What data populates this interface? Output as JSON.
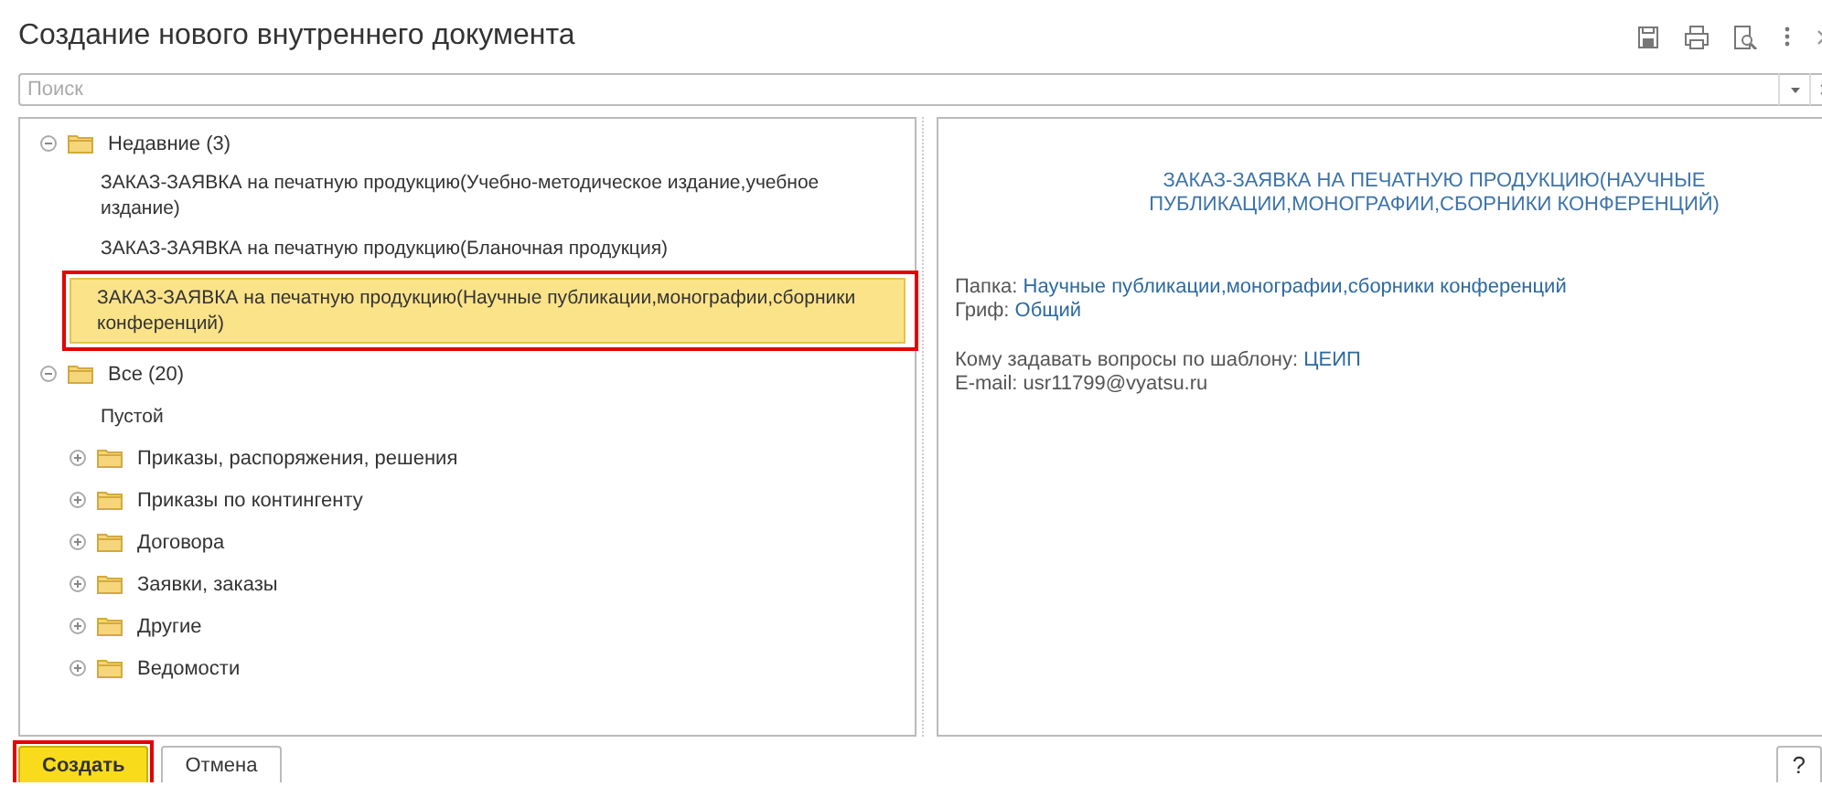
{
  "window": {
    "title": "Создание нового внутреннего документа"
  },
  "search": {
    "placeholder": "Поиск"
  },
  "tree": [
    {
      "kind": "folder",
      "label": "Недавние (3)",
      "expanded": true,
      "children": [
        {
          "kind": "item",
          "label": "ЗАКАЗ-ЗАЯВКА на печатную продукцию(Учебно-методическое издание,учебное издание)",
          "selected": false,
          "outlined": false
        },
        {
          "kind": "item",
          "label": "ЗАКАЗ-ЗАЯВКА на печатную продукцию(Бланочная продукция)",
          "selected": false,
          "outlined": false
        },
        {
          "kind": "item",
          "label": "ЗАКАЗ-ЗАЯВКА на печатную продукцию(Научные публикации,монографии,сборники конференций)",
          "selected": true,
          "outlined": true
        }
      ]
    },
    {
      "kind": "folder",
      "label": "Все (20)",
      "expanded": true,
      "children": [
        {
          "kind": "item",
          "label": "Пустой",
          "selected": false,
          "outlined": false
        },
        {
          "kind": "folder",
          "label": "Приказы, распоряжения, решения",
          "expanded": false
        },
        {
          "kind": "folder",
          "label": "Приказы по контингенту",
          "expanded": false
        },
        {
          "kind": "folder",
          "label": "Договора",
          "expanded": false
        },
        {
          "kind": "folder",
          "label": "Заявки, заказы",
          "expanded": false
        },
        {
          "kind": "folder",
          "label": "Другие",
          "expanded": false
        },
        {
          "kind": "folder",
          "label": "Ведомости",
          "expanded": false
        }
      ]
    }
  ],
  "preview": {
    "title": "ЗАКАЗ-ЗАЯВКА НА ПЕЧАТНУЮ ПРОДУКЦИЮ(НАУЧНЫЕ ПУБЛИКАЦИИ,МОНОГРАФИИ,СБОРНИКИ КОНФЕРЕНЦИЙ)",
    "blocks": [
      [
        {
          "label": "Папка:",
          "value": "Научные публикации,монографии,сборники конференций",
          "kind": "link"
        },
        {
          "label": "Гриф:",
          "value": "Общий",
          "kind": "link"
        }
      ],
      [
        {
          "label": "Кому задавать вопросы по шаблону:",
          "value": "ЦЕИП",
          "kind": "link"
        },
        {
          "label": "E-mail:",
          "value": "usr11799@vyatsu.ru",
          "kind": "plain"
        }
      ]
    ]
  },
  "buttons": [
    {
      "label": "Создать",
      "kind": "primary",
      "outlined": true
    },
    {
      "label": "Отмена",
      "kind": "normal",
      "outlined": false
    }
  ],
  "help": {
    "label": "?"
  }
}
